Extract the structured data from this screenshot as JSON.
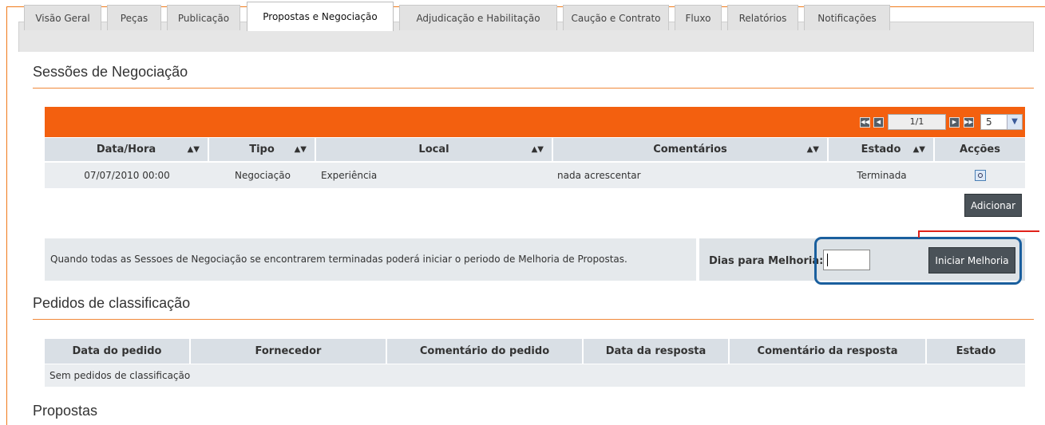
{
  "tabs": [
    {
      "label": "Visão Geral"
    },
    {
      "label": "Peças"
    },
    {
      "label": "Publicação"
    },
    {
      "label": "Propostas e Negociação"
    },
    {
      "label": "Adjudicação e Habilitação"
    },
    {
      "label": "Caução e Contrato"
    },
    {
      "label": "Fluxo"
    },
    {
      "label": "Relatórios"
    },
    {
      "label": "Notificações"
    }
  ],
  "active_tab": "Propostas e Negociação",
  "sessions": {
    "title": "Sessões de Negociação",
    "pager": {
      "page": "1/1",
      "page_size": "5"
    },
    "columns": [
      "Data/Hora",
      "Tipo",
      "Local",
      "Comentários",
      "Estado",
      "Acções"
    ],
    "rows": [
      {
        "data_hora": "07/07/2010 00:00",
        "tipo": "Negociação",
        "local": "Experiência",
        "comentarios": "nada acrescentar",
        "estado": "Terminada"
      }
    ],
    "add_button": "Adicionar",
    "info_text": "Quando todas as Sessoes de Negociação se encontrarem terminadas poderá iniciar o periodo de Melhoria de Propostas.",
    "dias_label": "Dias para Melhoria:",
    "dias_value": "",
    "start_button": "Iniciar Melhoria"
  },
  "pedidos": {
    "title": "Pedidos de classificação",
    "columns": [
      "Data do pedido",
      "Fornecedor",
      "Comentário do pedido",
      "Data da resposta",
      "Comentário da resposta",
      "Estado"
    ],
    "empty_text": "Sem pedidos de classificação"
  },
  "propostas": {
    "title": "Propostas"
  },
  "colors": {
    "accent": "#f3600f",
    "highlight": "#1a5f9e",
    "callout": "#e0211a"
  }
}
